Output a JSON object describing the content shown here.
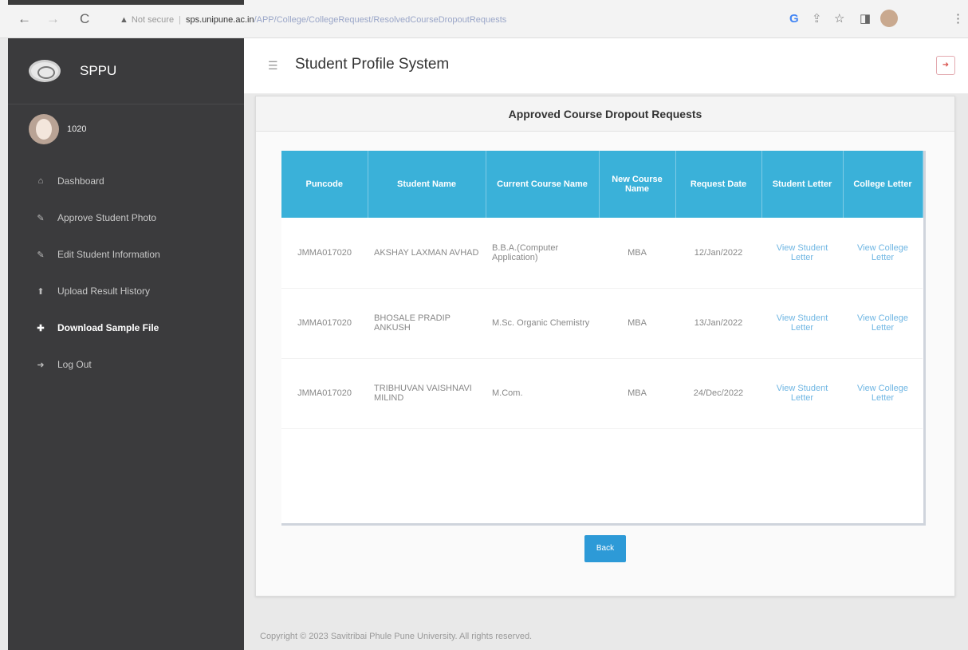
{
  "browser": {
    "back_icon": "←",
    "forward_icon": "→",
    "reload_icon": "C",
    "warning_icon": "▲",
    "not_secure": "Not secure",
    "domain": "sps.unipune.ac.in",
    "path": "/APP/College/CollegeRequest/ResolvedCourseDropoutRequests"
  },
  "sidebar": {
    "brand": "SPPU",
    "user": "1020",
    "items": [
      {
        "label": "Dashboard",
        "icon": "home-icon",
        "glyph": "⌂"
      },
      {
        "label": "Approve Student Photo",
        "icon": "edit-icon",
        "glyph": "✎"
      },
      {
        "label": "Edit Student Information",
        "icon": "edit-icon",
        "glyph": "✎"
      },
      {
        "label": "Upload Result History",
        "icon": "upload-icon",
        "glyph": "⬆"
      },
      {
        "label": "Download Sample File",
        "icon": "plus-icon",
        "glyph": "✚"
      },
      {
        "label": "Log Out",
        "icon": "logout-icon",
        "glyph": "➜"
      }
    ]
  },
  "header": {
    "title": "Student Profile System"
  },
  "card": {
    "title": "Approved Course Dropout Requests",
    "columns": [
      "Puncode",
      "Student Name",
      "Current Course Name",
      "New Course Name",
      "Request Date",
      "Student Letter",
      "College Letter"
    ],
    "rows": [
      {
        "puncode": "JMMA017020",
        "name": "AKSHAY LAXMAN AVHAD",
        "current_course": "B.B.A.(Computer Application)",
        "new_course": "MBA",
        "date": "12/Jan/2022",
        "student_letter": "View Student Letter",
        "college_letter": "View College Letter"
      },
      {
        "puncode": "JMMA017020",
        "name": "BHOSALE PRADIP ANKUSH",
        "current_course": "M.Sc. Organic Chemistry",
        "new_course": "MBA",
        "date": "13/Jan/2022",
        "student_letter": "View Student Letter",
        "college_letter": "View College Letter"
      },
      {
        "puncode": "JMMA017020",
        "name": "TRIBHUVAN VAISHNAVI MILIND",
        "current_course": "M.Com.",
        "new_course": "MBA",
        "date": "24/Dec/2022",
        "student_letter": "View Student Letter",
        "college_letter": "View College Letter"
      }
    ],
    "back_label": "Back"
  },
  "footer": {
    "text": "Copyright © 2023 Savitribai Phule Pune University. All rights reserved."
  },
  "colors": {
    "sidebar_bg": "#3b3b3d",
    "table_header": "#3ab1d9",
    "back_button": "#2d9ad7",
    "link": "#6fb6e3"
  }
}
